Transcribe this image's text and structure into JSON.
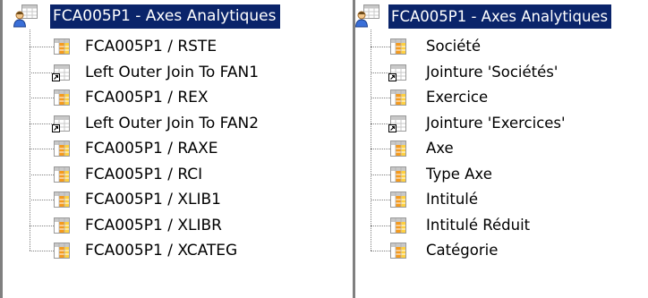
{
  "left_tree": {
    "root": {
      "label": "FCA005P1 - Axes Analytiques",
      "icon": "dataset-icon"
    },
    "items": [
      {
        "label": "FCA005P1 / RSTE",
        "icon": "table-icon",
        "kind": "table"
      },
      {
        "label": "Left Outer Join To FAN1",
        "icon": "join-icon",
        "kind": "join"
      },
      {
        "label": "FCA005P1 / REX",
        "icon": "table-icon",
        "kind": "table"
      },
      {
        "label": "Left Outer Join To FAN2",
        "icon": "join-icon",
        "kind": "join"
      },
      {
        "label": "FCA005P1 / RAXE",
        "icon": "table-icon",
        "kind": "table"
      },
      {
        "label": "FCA005P1 / RCI",
        "icon": "table-icon",
        "kind": "table"
      },
      {
        "label": "FCA005P1 / XLIB1",
        "icon": "table-icon",
        "kind": "table"
      },
      {
        "label": "FCA005P1 / XLIBR",
        "icon": "table-icon",
        "kind": "table"
      },
      {
        "label": "FCA005P1 / XCATEG",
        "icon": "table-icon",
        "kind": "table"
      }
    ]
  },
  "right_tree": {
    "root": {
      "label": "FCA005P1 - Axes Analytiques",
      "icon": "dataset-icon"
    },
    "items": [
      {
        "label": "Société",
        "icon": "table-icon",
        "kind": "table"
      },
      {
        "label": "Jointure 'Sociétés'",
        "icon": "join-icon",
        "kind": "join"
      },
      {
        "label": "Exercice",
        "icon": "table-icon",
        "kind": "table"
      },
      {
        "label": "Jointure 'Exercices'",
        "icon": "join-icon",
        "kind": "join"
      },
      {
        "label": "Axe",
        "icon": "table-icon",
        "kind": "table"
      },
      {
        "label": "Type Axe",
        "icon": "table-icon",
        "kind": "table"
      },
      {
        "label": "Intitulé",
        "icon": "table-icon",
        "kind": "table"
      },
      {
        "label": "Intitulé Réduit",
        "icon": "table-icon",
        "kind": "table"
      },
      {
        "label": "Catégorie",
        "icon": "table-icon",
        "kind": "table"
      }
    ]
  },
  "colors": {
    "selection_bg": "#0a246a",
    "selection_fg": "#ffffff",
    "connector": "#808080",
    "table_orange": "#f59a1c",
    "table_yellow": "#ffd040",
    "grid_gray": "#c8c8c8"
  }
}
